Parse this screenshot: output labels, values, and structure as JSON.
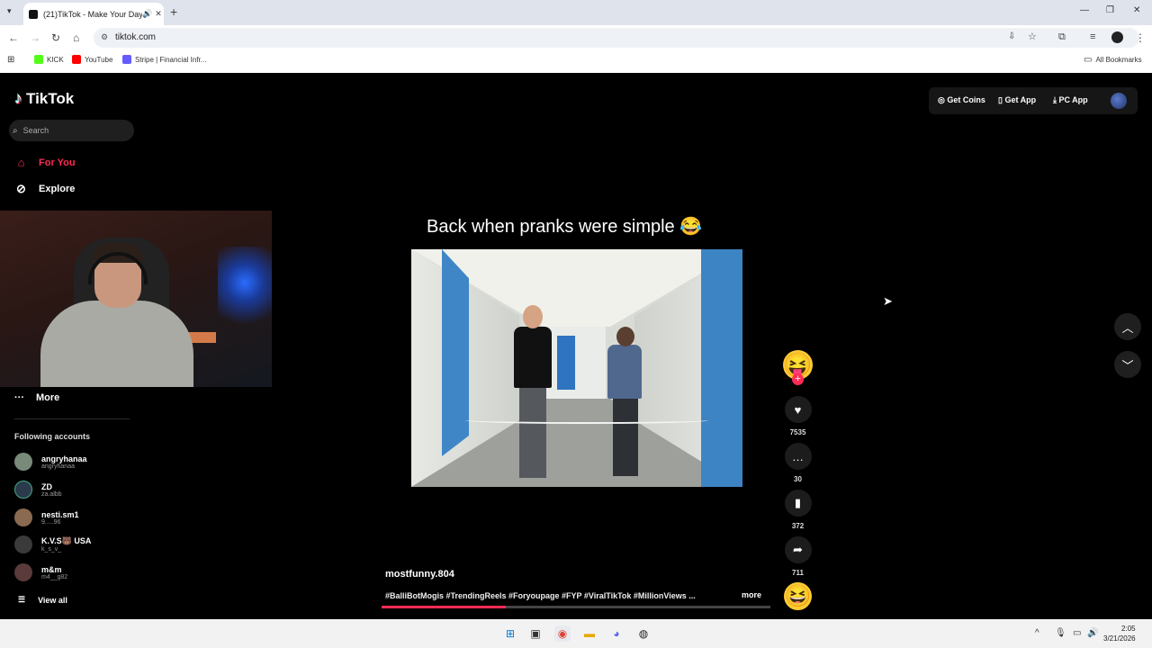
{
  "browser": {
    "tab_title": "(21)TikTok - Make Your Day",
    "url": "tiktok.com",
    "new_tab_symbol": "+",
    "bookmarks": [
      {
        "label": "KICK",
        "color": "#53fc18"
      },
      {
        "label": "YouTube",
        "color": "#ff0000"
      },
      {
        "label": "Stripe | Financial Infr...",
        "color": "#635bff"
      }
    ],
    "all_bookmarks": "All Bookmarks"
  },
  "sidebar": {
    "logo": "TikTok",
    "search_placeholder": "Search",
    "nav": [
      {
        "label": "For You",
        "icon": "home-icon",
        "color": "#fe2c55"
      },
      {
        "label": "Explore",
        "icon": "compass-icon",
        "color": "#ffffff"
      }
    ],
    "more": "More",
    "following_title": "Following accounts",
    "following": [
      {
        "name": "angryhanaa",
        "username": "angryhanaa",
        "color": "#7a8a7a"
      },
      {
        "name": "ZD",
        "username": "za.albb",
        "color": "#2a3a4a"
      },
      {
        "name": "nesti.sm1",
        "username": "9.....96",
        "color": "#8a6a50"
      },
      {
        "name": "K.V.S🐻 USA",
        "username": "k_s_v_",
        "color": "#3a3a3a"
      },
      {
        "name": "m&m",
        "username": "m4__g82",
        "color": "#5a3a3a"
      }
    ],
    "view_all": "View all"
  },
  "header": {
    "get_coins": "Get Coins",
    "get_app": "Get App",
    "pc_app": "PC App"
  },
  "video": {
    "caption": "Back when pranks were simple 😂",
    "author": "mostfunny.804",
    "hashtags": "#BalliBotMogis #TrendingReels #Foryoupage #FYP #ViralTikTok #MillionViews ...",
    "more": "more",
    "progress": 0.32,
    "creator_emoji": "😝",
    "music_emoji": "😆",
    "likes": "7535",
    "comments": "30",
    "saves": "372",
    "shares": "711"
  },
  "taskbar": {
    "time": "2:05",
    "date": "3/21/2026"
  }
}
